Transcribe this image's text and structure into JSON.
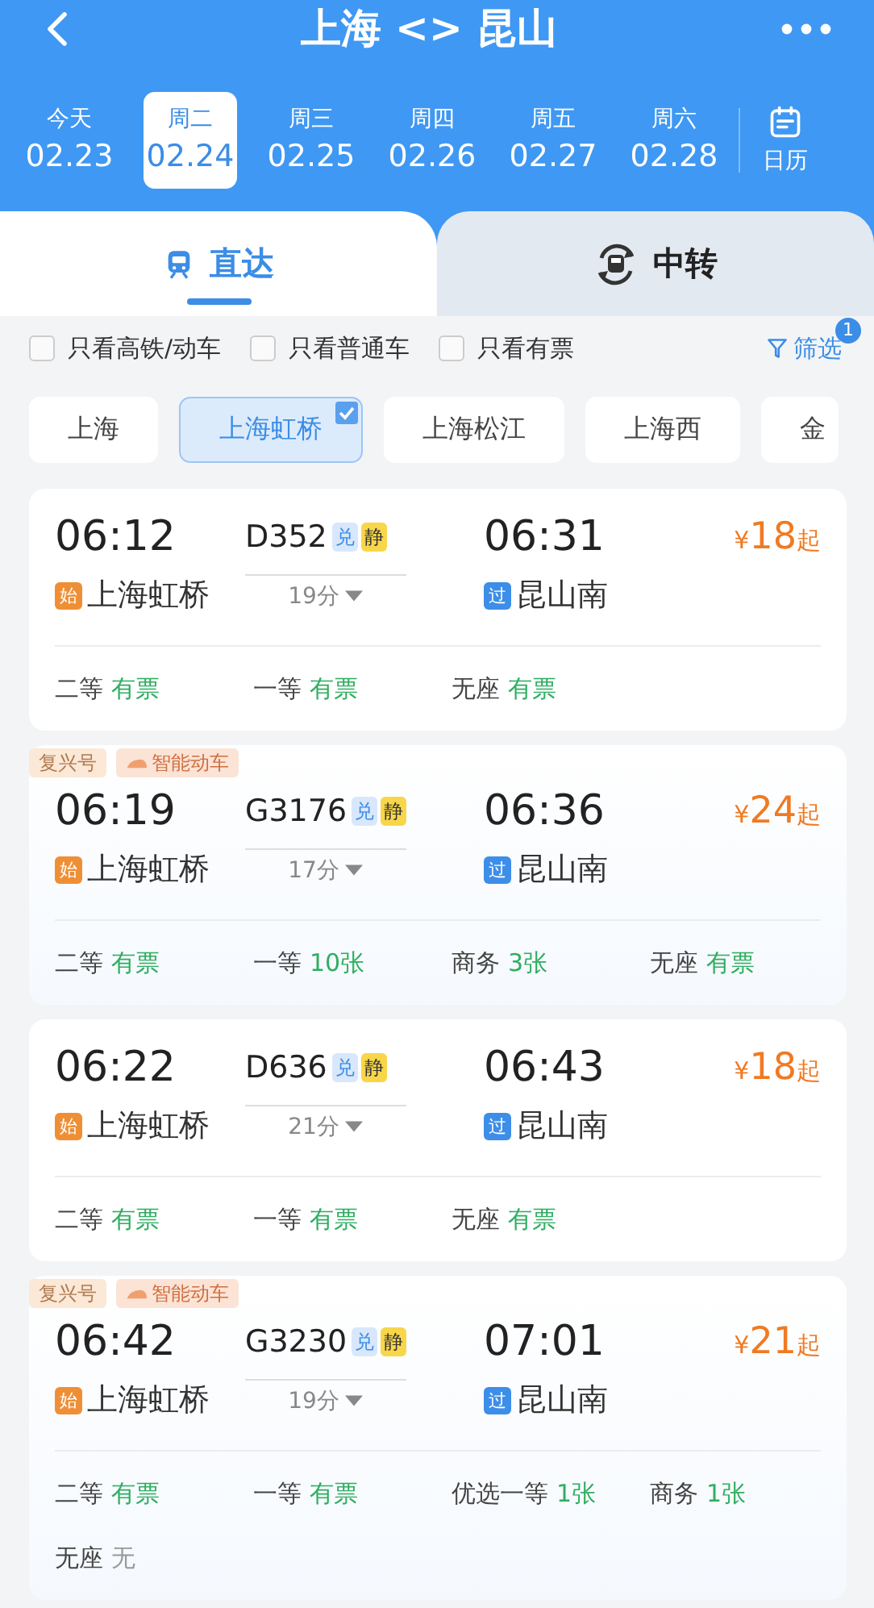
{
  "header": {
    "title": "上海 <> 昆山"
  },
  "dates": [
    {
      "weekday": "今天",
      "date": "02.23",
      "selected": false
    },
    {
      "weekday": "周二",
      "date": "02.24",
      "selected": true
    },
    {
      "weekday": "周三",
      "date": "02.25",
      "selected": false
    },
    {
      "weekday": "周四",
      "date": "02.26",
      "selected": false
    },
    {
      "weekday": "周五",
      "date": "02.27",
      "selected": false
    },
    {
      "weekday": "周六",
      "date": "02.28",
      "selected": false
    }
  ],
  "calendar": {
    "label": "日历"
  },
  "tabs": [
    {
      "kind": "direct",
      "label": "直达",
      "selected": true
    },
    {
      "kind": "transfer",
      "label": "中转",
      "selected": false
    }
  ],
  "filters": [
    {
      "label": "只看高铁/动车",
      "checked": false
    },
    {
      "label": "只看普通车",
      "checked": false
    },
    {
      "label": "只看有票",
      "checked": false
    }
  ],
  "filter_button": {
    "label": "筛选",
    "count": "1"
  },
  "stations": [
    {
      "label": "上海",
      "selected": false
    },
    {
      "label": "上海虹桥",
      "selected": true
    },
    {
      "label": "上海松江",
      "selected": false
    },
    {
      "label": "上海西",
      "selected": false
    },
    {
      "label": "金",
      "selected": false
    }
  ],
  "trains": [
    {
      "depart_time": "06:12",
      "train_no": "D352",
      "badges": [
        {
          "kind": "exchange",
          "label": "兑"
        },
        {
          "kind": "quiet",
          "label": "静"
        }
      ],
      "arrive_time": "06:31",
      "currency": "¥",
      "price": "18",
      "price_suffix": "起",
      "from": {
        "kind": "start",
        "mark": "始",
        "name": "上海虹桥"
      },
      "duration": "19分",
      "to": {
        "kind": "pass",
        "mark": "过",
        "name": "昆山南"
      },
      "seats": [
        {
          "label": "二等",
          "status": "有票",
          "available": true
        },
        {
          "label": "一等",
          "status": "有票",
          "available": true
        },
        {
          "label": "无座",
          "status": "有票",
          "available": true
        }
      ]
    },
    {
      "tags": [
        {
          "kind": "fuxing",
          "label": "复兴号"
        },
        {
          "kind": "smart",
          "label": "智能动车"
        }
      ],
      "depart_time": "06:19",
      "train_no": "G3176",
      "badges": [
        {
          "kind": "exchange",
          "label": "兑"
        },
        {
          "kind": "quiet",
          "label": "静"
        }
      ],
      "arrive_time": "06:36",
      "currency": "¥",
      "price": "24",
      "price_suffix": "起",
      "from": {
        "kind": "start",
        "mark": "始",
        "name": "上海虹桥"
      },
      "duration": "17分",
      "to": {
        "kind": "pass",
        "mark": "过",
        "name": "昆山南"
      },
      "seats": [
        {
          "label": "二等",
          "status": "有票",
          "available": true
        },
        {
          "label": "一等",
          "status": "10张",
          "available": true
        },
        {
          "label": "商务",
          "status": "3张",
          "available": true
        },
        {
          "label": "无座",
          "status": "有票",
          "available": true
        }
      ]
    },
    {
      "depart_time": "06:22",
      "train_no": "D636",
      "badges": [
        {
          "kind": "exchange",
          "label": "兑"
        },
        {
          "kind": "quiet",
          "label": "静"
        }
      ],
      "arrive_time": "06:43",
      "currency": "¥",
      "price": "18",
      "price_suffix": "起",
      "from": {
        "kind": "start",
        "mark": "始",
        "name": "上海虹桥"
      },
      "duration": "21分",
      "to": {
        "kind": "pass",
        "mark": "过",
        "name": "昆山南"
      },
      "seats": [
        {
          "label": "二等",
          "status": "有票",
          "available": true
        },
        {
          "label": "一等",
          "status": "有票",
          "available": true
        },
        {
          "label": "无座",
          "status": "有票",
          "available": true
        }
      ]
    },
    {
      "tags": [
        {
          "kind": "fuxing",
          "label": "复兴号"
        },
        {
          "kind": "smart",
          "label": "智能动车"
        }
      ],
      "depart_time": "06:42",
      "train_no": "G3230",
      "badges": [
        {
          "kind": "exchange",
          "label": "兑"
        },
        {
          "kind": "quiet",
          "label": "静"
        }
      ],
      "arrive_time": "07:01",
      "currency": "¥",
      "price": "21",
      "price_suffix": "起",
      "from": {
        "kind": "start",
        "mark": "始",
        "name": "上海虹桥"
      },
      "duration": "19分",
      "to": {
        "kind": "pass",
        "mark": "过",
        "name": "昆山南"
      },
      "seats": [
        {
          "label": "二等",
          "status": "有票",
          "available": true
        },
        {
          "label": "一等",
          "status": "有票",
          "available": true
        },
        {
          "label": "优选一等",
          "status": "1张",
          "available": true
        },
        {
          "label": "商务",
          "status": "1张",
          "available": true
        },
        {
          "label": "无座",
          "status": "无",
          "available": false
        }
      ]
    }
  ]
}
